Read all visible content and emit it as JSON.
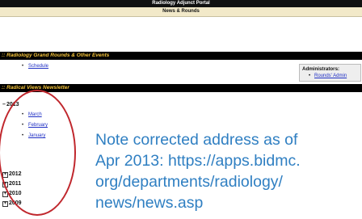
{
  "portal": {
    "title": "Radiology Adjunct Portal",
    "subtitle": "News & Rounds"
  },
  "events": {
    "header": ":: Radiology Grand Rounds & Other Events",
    "items": [
      {
        "label": "Schedule"
      }
    ]
  },
  "admin": {
    "title": "Administrators:",
    "link": "Rounds' Admin"
  },
  "newsletter": {
    "header": ":: Radical Views Newsletter",
    "expanded_year": {
      "year": "2013",
      "months": [
        "March",
        "February",
        "January"
      ]
    },
    "collapsed_years": [
      "2012",
      "2011",
      "2010",
      "2009"
    ]
  },
  "note": {
    "lines": [
      "Note corrected address as of",
      "Apr 2013: https://apps.bidmc.",
      "org/departments/radiology/",
      "news/news.asp"
    ]
  },
  "colors": {
    "portal_bar": "#111111",
    "subtitle_bar": "#f2e9c9",
    "section_header_text": "#f3c23a",
    "link": "#1f2fc4",
    "annotation_circle": "#c0272d",
    "note_text": "#2f7fc2"
  }
}
